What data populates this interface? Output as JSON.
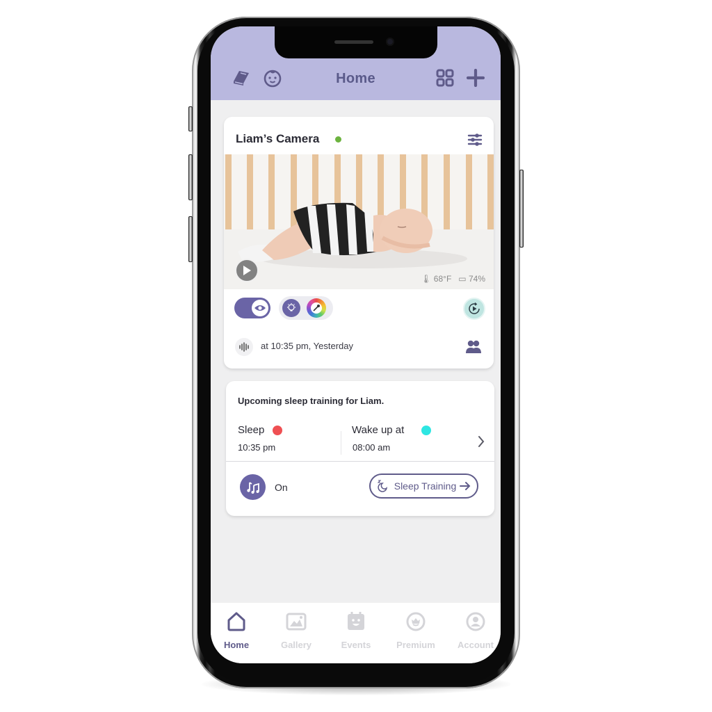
{
  "header": {
    "title": "Home",
    "left_icons": [
      "book-icon",
      "baby-face-icon"
    ],
    "right_icons": [
      "grid-icon",
      "plus-icon"
    ]
  },
  "camera_card": {
    "name": "Liam’s Camera",
    "status": "online",
    "status_color": "#6cb33f",
    "temperature": "68°F",
    "battery": "74%",
    "last_event": "at 10:35 pm, Yesterday",
    "night_vision_toggle": "on"
  },
  "sleep_card": {
    "heading": "Upcoming sleep training for Liam.",
    "sleep_label": "Sleep",
    "sleep_time": "10:35 pm",
    "sleep_color": "#ef5053",
    "wake_label": "Wake up at",
    "wake_time": "08:00 am",
    "wake_color": "#2ee6e2",
    "music_state": "On",
    "sleep_training_button": "Sleep Training"
  },
  "tabs": [
    {
      "label": "Home",
      "icon": "home-icon",
      "active": true
    },
    {
      "label": "Gallery",
      "icon": "gallery-icon",
      "active": false
    },
    {
      "label": "Events",
      "icon": "events-icon",
      "active": false
    },
    {
      "label": "Premium",
      "icon": "premium-icon",
      "active": false
    },
    {
      "label": "Account",
      "icon": "account-icon",
      "active": false
    }
  ],
  "colors": {
    "accent": "#6a64a6",
    "header_bg": "#b9b8df",
    "header_text": "#5a5a8a",
    "inactive_tab": "#d4d4d8"
  }
}
